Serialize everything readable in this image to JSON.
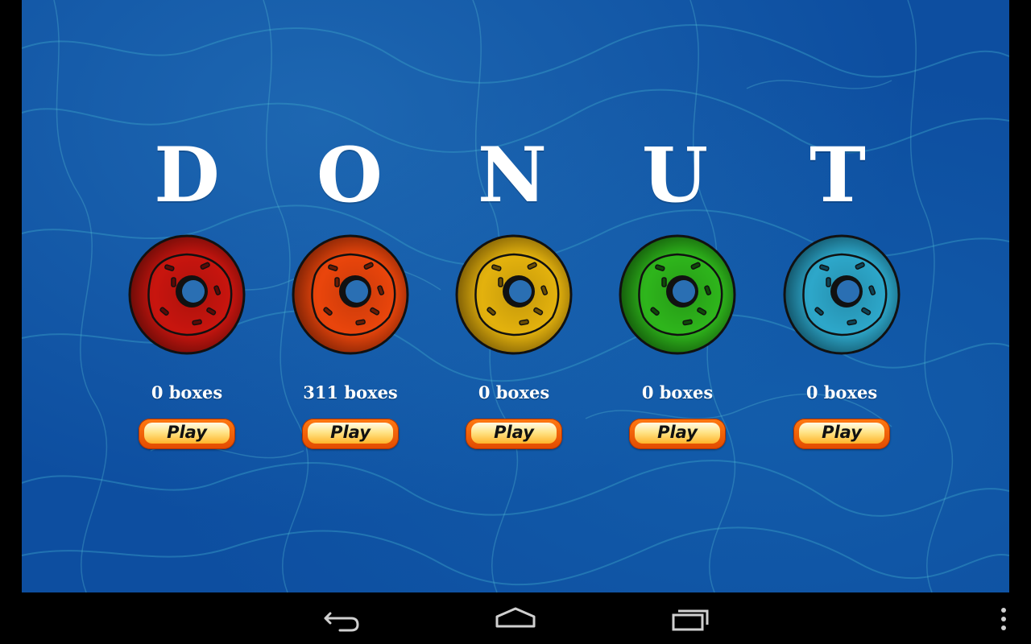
{
  "title": {
    "letters": [
      "D",
      "O",
      "N",
      "U",
      "T"
    ]
  },
  "levels": [
    {
      "donut_color": "red",
      "fill": "#c8150f",
      "dark": "#5a0a06",
      "count_label": "0 boxes",
      "play_label": "Play"
    },
    {
      "donut_color": "orange",
      "fill": "#e9460c",
      "dark": "#6b1c04",
      "count_label": "311 boxes",
      "play_label": "Play"
    },
    {
      "donut_color": "yellow",
      "fill": "#e3b20e",
      "dark": "#6b4e04",
      "count_label": "0 boxes",
      "play_label": "Play"
    },
    {
      "donut_color": "green",
      "fill": "#2fb51c",
      "dark": "#0f4a08",
      "count_label": "0 boxes",
      "play_label": "Play"
    },
    {
      "donut_color": "blue",
      "fill": "#2ea7c9",
      "dark": "#0d4558",
      "count_label": "0 boxes",
      "play_label": "Play"
    }
  ],
  "nav_bar": {
    "buttons": [
      "back-icon",
      "home-icon",
      "recent-apps-icon",
      "overflow-menu-icon"
    ]
  },
  "colors": {
    "background": "#0d4ea0",
    "button_rim": "#e24a00",
    "text": "#ffffff"
  }
}
